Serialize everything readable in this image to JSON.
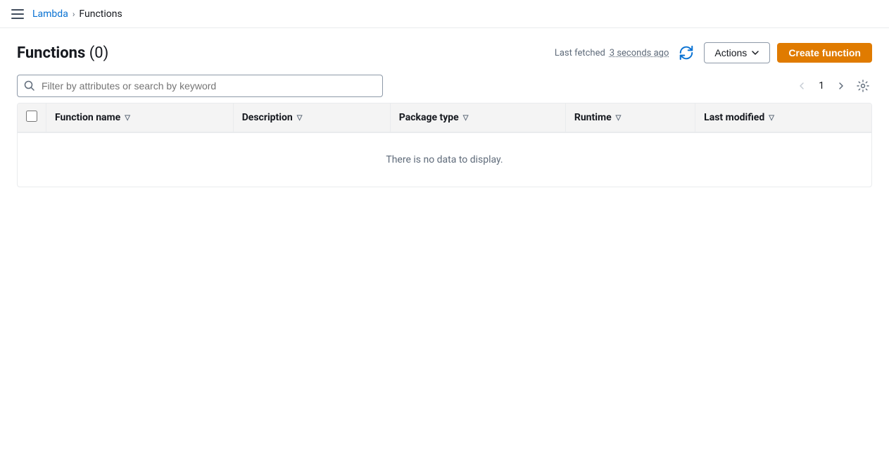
{
  "nav": {
    "hamburger_label": "Menu",
    "breadcrumb_link": "Lambda",
    "breadcrumb_separator": ">",
    "breadcrumb_current": "Functions"
  },
  "page": {
    "title": "Functions",
    "count": "(0)",
    "last_fetched_label": "Last fetched",
    "last_fetched_time": "3 seconds ago",
    "actions_label": "Actions",
    "create_function_label": "Create function"
  },
  "search": {
    "placeholder": "Filter by attributes or search by keyword"
  },
  "pagination": {
    "page_number": "1"
  },
  "table": {
    "columns": [
      {
        "id": "function-name",
        "label": "Function name",
        "sortable": true
      },
      {
        "id": "description",
        "label": "Description",
        "sortable": true
      },
      {
        "id": "package-type",
        "label": "Package type",
        "sortable": true
      },
      {
        "id": "runtime",
        "label": "Runtime",
        "sortable": true
      },
      {
        "id": "last-modified",
        "label": "Last modified",
        "sortable": true
      }
    ],
    "empty_message": "There is no data to display."
  }
}
